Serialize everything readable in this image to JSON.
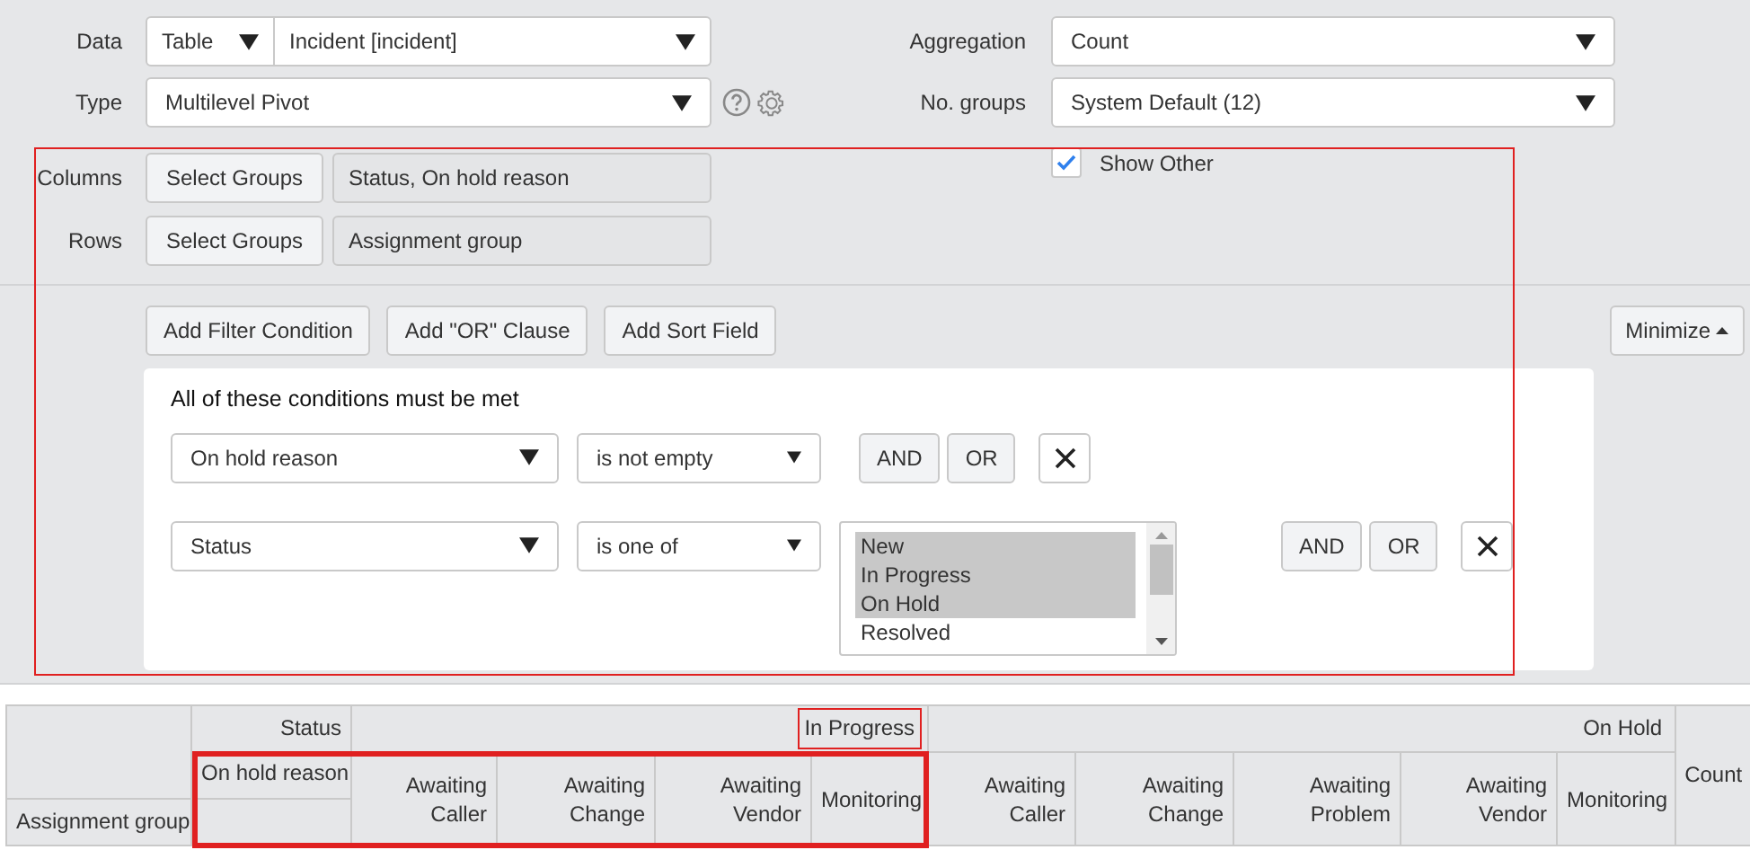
{
  "settings": {
    "data": {
      "label": "Data",
      "source": "Table",
      "table": "Incident [incident]"
    },
    "type": {
      "label": "Type",
      "value": "Multilevel Pivot"
    },
    "aggregation": {
      "label": "Aggregation",
      "value": "Count"
    },
    "groups": {
      "label": "No. groups",
      "value": "System Default (12)"
    }
  },
  "group_by": {
    "highlighted": true,
    "rows": [
      {
        "label": "Columns",
        "button": "Select Groups",
        "value": "Status, On hold reason"
      },
      {
        "label": "Rows",
        "button": "Select Groups",
        "value": "Assignment group"
      }
    ],
    "show_other": {
      "label": "Show Other",
      "checked": true
    }
  },
  "filter": {
    "buttons": [
      "Add Filter Condition",
      "Add \"OR\" Clause",
      "Add Sort Field"
    ],
    "minimize": "Minimize",
    "heading": "All of these conditions must be met",
    "conditions": [
      {
        "kind": "select",
        "field": "On hold reason",
        "operator": "is not empty",
        "and": "AND",
        "or": "OR"
      },
      {
        "kind": "list",
        "field": "Status",
        "operator": "is one of",
        "options": [
          {
            "label": "New",
            "selected": true
          },
          {
            "label": "In Progress",
            "selected": true
          },
          {
            "label": "On Hold",
            "selected": true
          },
          {
            "label": "Resolved",
            "selected": false
          }
        ],
        "and": "AND",
        "or": "OR"
      }
    ]
  },
  "pivot": {
    "status_label": "Status",
    "reason_label": "On hold reason",
    "row_label": "Assignment group",
    "count_label": "Count",
    "statuses": [
      {
        "label": "In Progress",
        "highlighted": true,
        "reasons_highlighted": true,
        "reasons": [
          "Awaiting Caller",
          "Awaiting Change",
          "Awaiting Vendor",
          "Monitoring"
        ]
      },
      {
        "label": "On Hold",
        "highlighted": false,
        "reasons": [
          "Awaiting Caller",
          "Awaiting Change",
          "Awaiting Problem",
          "Awaiting Vendor",
          "Monitoring"
        ]
      }
    ]
  }
}
